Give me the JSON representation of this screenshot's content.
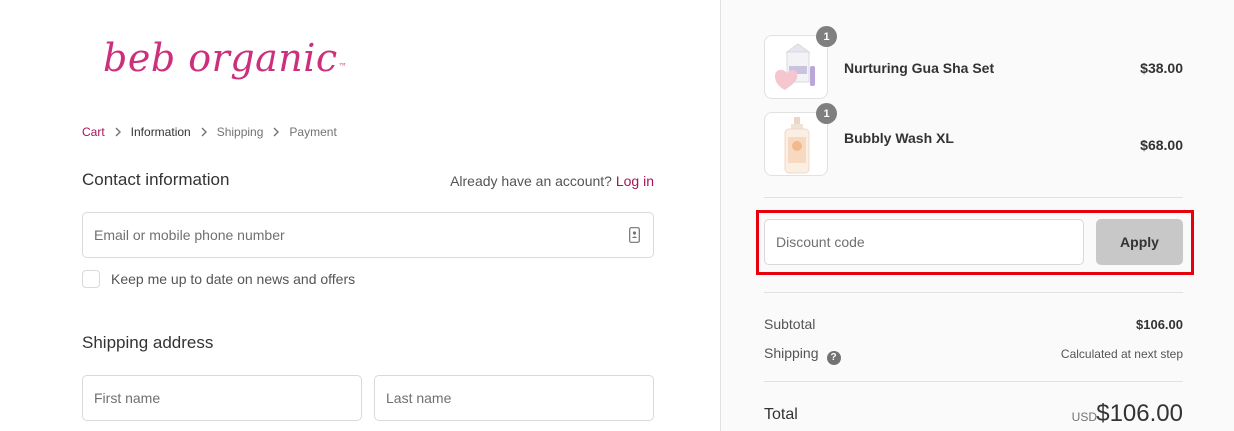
{
  "brand": {
    "logo_text": "beb organic",
    "logo_tm": "™",
    "color": "#cc2f7c"
  },
  "breadcrumb": {
    "items": [
      {
        "label": "Cart",
        "state": "link"
      },
      {
        "label": "Information",
        "state": "current"
      },
      {
        "label": "Shipping",
        "state": "upcoming"
      },
      {
        "label": "Payment",
        "state": "upcoming"
      }
    ]
  },
  "contact": {
    "title": "Contact information",
    "account_prompt": "Already have an account?",
    "login_label": "Log in",
    "email_placeholder": "Email or mobile phone number",
    "newsletter_label": "Keep me up to date on news and offers",
    "newsletter_checked": false
  },
  "shipping": {
    "title": "Shipping address",
    "first_name_placeholder": "First name",
    "last_name_placeholder": "Last name"
  },
  "order": {
    "items": [
      {
        "name": "Nurturing Gua Sha Set",
        "price": "$38.00",
        "quantity": "1",
        "image": "gua-sha-set-thumbnail"
      },
      {
        "name": "Bubbly Wash XL",
        "price": "$68.00",
        "quantity": "1",
        "image": "bubbly-wash-thumbnail"
      }
    ],
    "discount": {
      "placeholder": "Discount code",
      "apply_label": "Apply"
    },
    "subtotal_label": "Subtotal",
    "subtotal_value": "$106.00",
    "shipping_label": "Shipping",
    "shipping_value": "Calculated at next step",
    "total_label": "Total",
    "total_currency": "USD",
    "total_value": "$106.00"
  },
  "colors": {
    "accent": "#a3145c",
    "highlight": "#e8000d",
    "button_disabled": "#c8c8c8"
  }
}
